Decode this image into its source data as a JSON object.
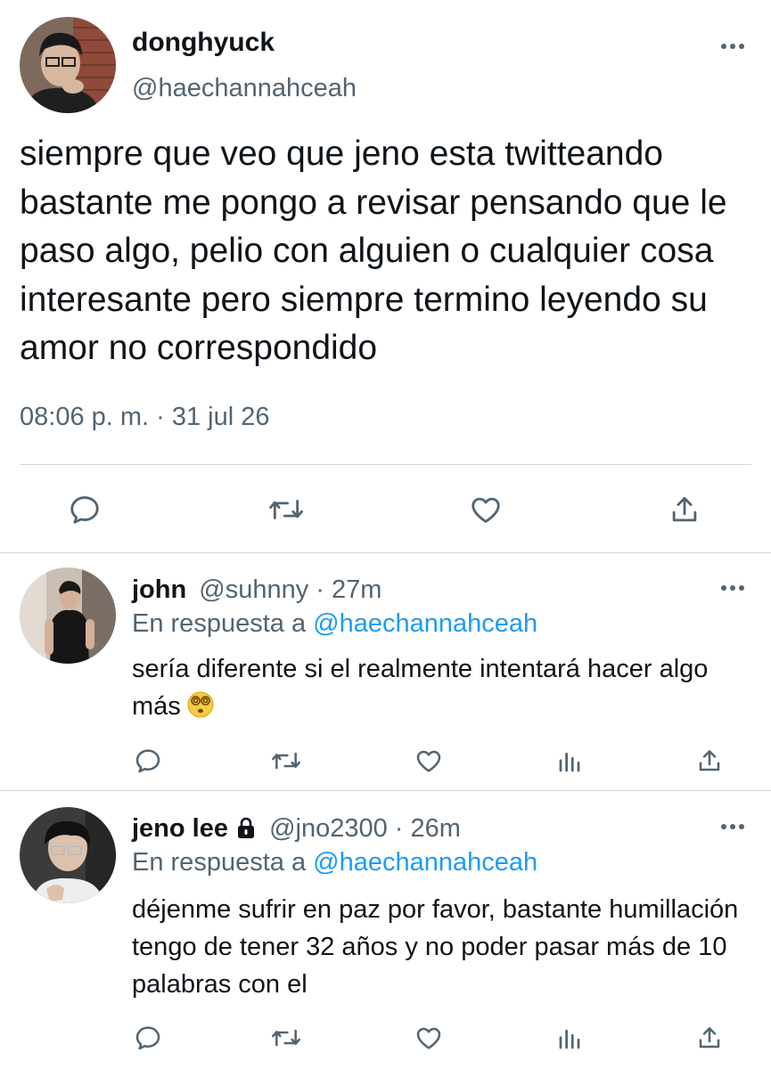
{
  "main_tweet": {
    "author_name": "donghyuck",
    "author_handle": "@haechannahceah",
    "text": "siempre que veo que jeno esta twitteando bastante me pongo a revisar pensando que le paso algo, pelio con alguien o cualquier cosa interesante pero siempre termino leyendo su amor no correspondido",
    "timestamp": "08:06 p. m. · 31 jul 26",
    "actions": [
      "reply-icon",
      "retweet-icon",
      "like-icon",
      "share-icon"
    ]
  },
  "replies": [
    {
      "author_name": "john",
      "author_handle": "@suhnny",
      "separator": "·",
      "time": "27m",
      "replying_prefix": "En respuesta a",
      "replying_to": "@haechannahceah",
      "text": "sería diferente si el realmente intentará hacer algo más",
      "emoji": "dizzy-face-emoji",
      "actions": [
        "reply-icon",
        "retweet-icon",
        "like-icon",
        "analytics-icon",
        "share-icon"
      ]
    },
    {
      "author_name": "jeno lee",
      "protected": true,
      "author_handle": "@jno2300",
      "separator": "·",
      "time": "26m",
      "replying_prefix": "En respuesta a",
      "replying_to": "@haechannahceah",
      "text": "déjenme sufrir en paz por favor, bastante humillación tengo de tener 32 años y no poder pasar más de 10 palabras con el",
      "actions": [
        "reply-icon",
        "retweet-icon",
        "like-icon",
        "analytics-icon",
        "share-icon"
      ]
    }
  ],
  "colors": {
    "text_primary": "#0f1419",
    "text_secondary": "#536471",
    "link": "#1d9bf0",
    "divider": "#cfd9de"
  }
}
